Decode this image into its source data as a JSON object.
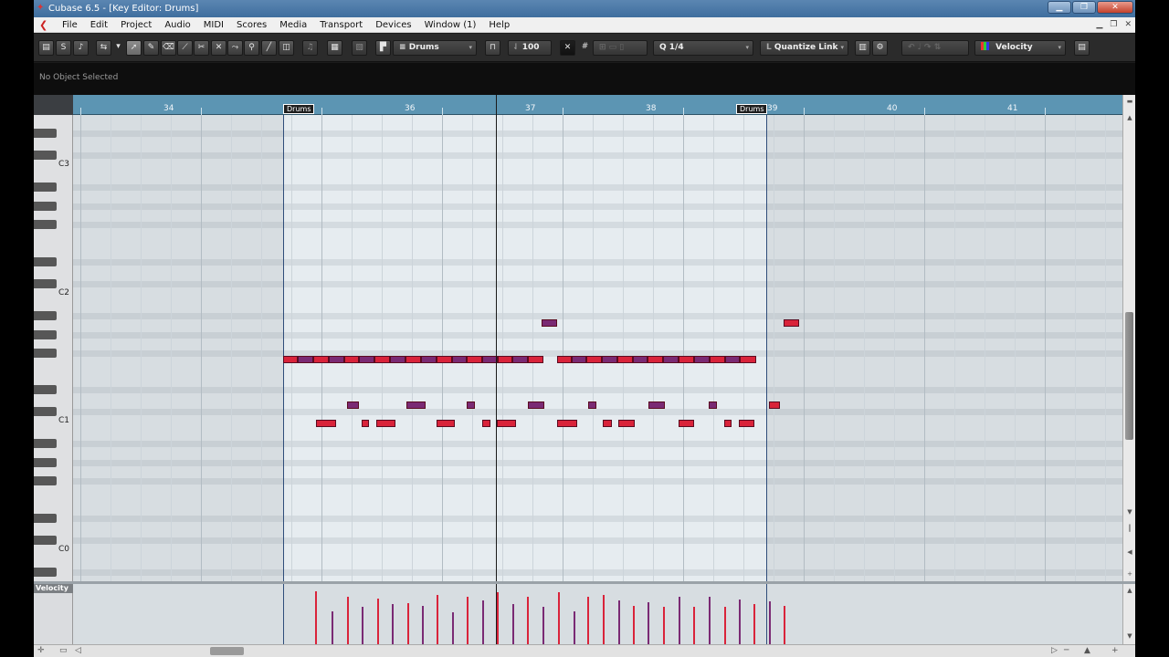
{
  "window": {
    "title": "Cubase 6.5 - [Key Editor: Drums]"
  },
  "menu": [
    "File",
    "Edit",
    "Project",
    "Audio",
    "MIDI",
    "Scores",
    "Media",
    "Transport",
    "Devices",
    "Window (1)",
    "Help"
  ],
  "toolbar": {
    "track_name": "Drums",
    "velocity_value": "100",
    "quantize": "1/4",
    "quantize_link": "Quantize Link",
    "controller_lane": "Velocity"
  },
  "info_line": {
    "status": "No Object Selected"
  },
  "ruler": {
    "bars": [
      "34",
      "36",
      "37",
      "38",
      "40",
      "41"
    ],
    "part_start_label": "Drums",
    "part_end_label": "Drums",
    "part_end_bar": "39"
  },
  "keys": {
    "labels": [
      "C3",
      "C2",
      "C1",
      "C0"
    ]
  },
  "controller": {
    "name": "Velocity"
  },
  "colors": {
    "note_red": "#d9233a",
    "note_purple": "#7a2a74",
    "ruler": "#5c95b3",
    "part_edge": "#2f4d7a"
  }
}
